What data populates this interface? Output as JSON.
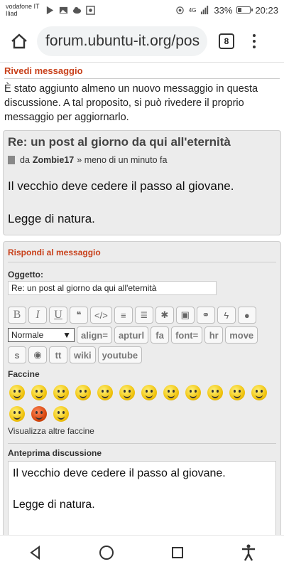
{
  "status_bar": {
    "carrier_line1": "vodafone IT",
    "carrier_line2": "Iliad",
    "network": "4G",
    "battery_percent_text": "33%",
    "battery_level": 0.33,
    "time": "20:23"
  },
  "browser": {
    "url": "forum.ubuntu-it.org/pos",
    "tab_count": "8"
  },
  "review": {
    "title": "Rivedi messaggio",
    "text": "È stato aggiunto almeno un nuovo messaggio in questa discussione. A tal proposito, si può rivedere il proprio messaggio per aggiornarlo."
  },
  "post": {
    "title": "Re: un post al giorno da qui all'eternità",
    "by_prefix": "da",
    "author": "Zombie17",
    "time_text": "» meno di un minuto fa",
    "paragraph1": "Il vecchio deve cedere il passo al giovane.",
    "paragraph2": "Legge di natura."
  },
  "reply": {
    "title": "Rispondi al messaggio",
    "subject_label": "Oggetto:",
    "subject_value": "Re: un post al giorno da qui all'eternità",
    "toolbar": {
      "bold": "B",
      "italic": "I",
      "underline": "U",
      "quote": "❝",
      "code": "</>",
      "list": "≡",
      "list_numbered": "≣",
      "list_item": "✱",
      "image": "▣",
      "link": "⚭",
      "flash": "ϟ",
      "color": "●",
      "size_select": "Normale",
      "align": "align=",
      "apturl": "apturl",
      "fa": "fa",
      "font": "font=",
      "hr": "hr",
      "move": "move",
      "s": "s",
      "spoiler": "◉",
      "tt": "tt",
      "wiki": "wiki",
      "youtube": "youtube"
    },
    "smileys_label": "Faccine",
    "smileys": [
      "smiley-1",
      "smiley-2",
      "smiley-3",
      "smiley-4",
      "smiley-5",
      "smiley-6",
      "smiley-7",
      "smiley-8",
      "smiley-9",
      "smiley-10",
      "smiley-11",
      "smiley-12",
      "smiley-13",
      "smiley-14",
      "smiley-15"
    ],
    "more_smileys": "Visualizza altre faccine",
    "preview_label": "Anteprima discussione",
    "preview_p1": "Il vecchio deve cedere il passo al giovane.",
    "preview_p2": "Legge di natura."
  },
  "colors": {
    "accent": "#c8401a",
    "panel": "#ececec"
  }
}
